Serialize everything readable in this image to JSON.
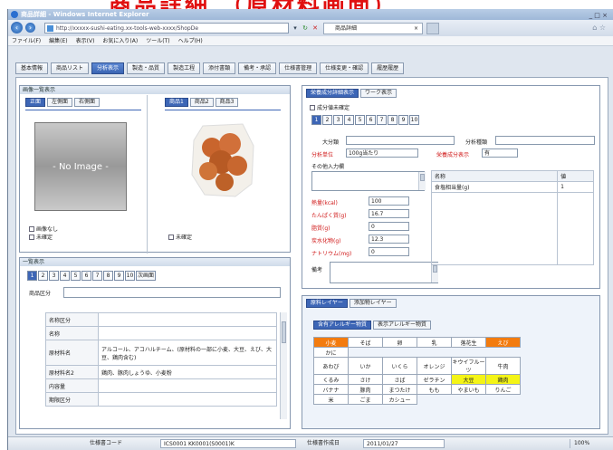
{
  "banner": {
    "text": "商品詳細 （原材料画面）"
  },
  "window": {
    "title": "商品詳細 - Windows Internet Explorer",
    "controls": "_ □ ×"
  },
  "address": {
    "url": "http://xxxxx-sushi-eating.xx-tools-web-xxxx/ShopDe",
    "tab_title": "商品詳細",
    "back_icon": "back-arrow-icon",
    "forward_icon": "forward-arrow-icon"
  },
  "menubar": [
    "ファイル(F)",
    "編集(E)",
    "表示(V)",
    "お気に入り(A)",
    "ツール(T)",
    "ヘルプ(H)"
  ],
  "main_tabs": [
    "基本情報",
    "商品リスト",
    "分析表示",
    "製造・品質",
    "製造工程",
    "添付書類",
    "備考・承認",
    "仕様書管理",
    "仕様変更・確認",
    "履歴履歴"
  ],
  "left_top": {
    "header": "画像一覧表示",
    "tabs": [
      "正面",
      "左側面",
      "右側面"
    ],
    "noimage": "- No Image -",
    "checks": [
      "画像なし",
      "未確定"
    ],
    "tabs2": [
      "商品1",
      "商品2",
      "商品3"
    ],
    "check2": "未確定"
  },
  "list": {
    "header": "一覧表示",
    "nums": [
      "1",
      "2",
      "3",
      "4",
      "5",
      "6",
      "7",
      "8",
      "9",
      "10",
      "次画面"
    ],
    "filter_label": "商品区分",
    "rows": [
      [
        "名称区分",
        ""
      ],
      [
        "名称",
        ""
      ],
      [
        "原材料名",
        "アルコール、アコハルチーム、(原材料の一部に小麦、大豆、えび、大豆、鶏肉含む)"
      ],
      [
        "原材料名2",
        "鶏肉、豚肉しょうゆ、小麦粉"
      ],
      [
        "内容量",
        ""
      ],
      [
        "期限区分",
        ""
      ]
    ]
  },
  "detail": {
    "tabs": [
      "栄養成分詳細表示",
      "ワーク表示"
    ],
    "check": "成分値未確定",
    "nums": [
      "1",
      "2",
      "3",
      "4",
      "5",
      "6",
      "7",
      "8",
      "9",
      "10"
    ],
    "sub_label": "大分類",
    "sub_label2": "分析種類",
    "unit_label": "分析単位",
    "unit_value": "100g当たり",
    "disp_label": "栄養成分表示",
    "disp_value": "有",
    "extra_label": "その他入力欄",
    "nutr": [
      {
        "label": "熱量(kcal)",
        "value": "100"
      },
      {
        "label": "たんぱく質(g)",
        "value": "16.7"
      },
      {
        "label": "脂質(g)",
        "value": "0"
      },
      {
        "label": "炭水化物(g)",
        "value": "12.3"
      },
      {
        "label": "ナトリウム(mg)",
        "value": "0"
      }
    ],
    "note_label": "備考",
    "rt_headers": [
      "名称",
      "値"
    ],
    "rt_rows": [
      [
        "食塩相当量(g)",
        "1"
      ]
    ]
  },
  "allergy": {
    "tabs": [
      "原料レイヤー",
      "添加物レイヤー"
    ],
    "subtabs": [
      "含有アレルギー物質",
      "表示アレルギー物質"
    ],
    "grid": [
      [
        "小麦",
        "そば",
        "卵",
        "乳",
        "落花生",
        "えび"
      ],
      [
        "かに",
        "",
        "",
        "",
        "",
        ""
      ],
      [
        "あわび",
        "いか",
        "いくら",
        "オレンジ",
        "キウイフルーツ",
        "牛肉"
      ],
      [
        "くるみ",
        "さけ",
        "さば",
        "ゼラチン",
        "大豆",
        "鶏肉"
      ],
      [
        "バナナ",
        "豚肉",
        "まつたけ",
        "もも",
        "やまいも",
        "りんご"
      ],
      [
        "米",
        "ごま",
        "カシュー",
        "",
        "",
        ""
      ]
    ]
  },
  "status": {
    "label1": "仕様書コード",
    "value1": "ICS0001 KK0001(S0001)K",
    "label2": "仕様書作成日",
    "value2": "2011/01/27",
    "zoom": "100%"
  }
}
